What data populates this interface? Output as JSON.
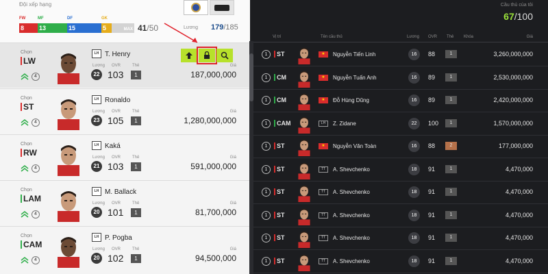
{
  "left_header": {
    "rank_title": "Đội xếp hạng",
    "pos_labels": [
      "FW",
      "MF",
      "DF",
      "GK"
    ],
    "bar_values": [
      "8",
      "13",
      "15",
      "5"
    ],
    "bar_max": "MAX",
    "count": "41",
    "count_total": "/50",
    "salary_label": "Lương",
    "salary": "179",
    "salary_total": "/185"
  },
  "card_labels": {
    "pick": "Chọn",
    "salary": "Lương",
    "ovr": "OVR",
    "grade": "Thẻ",
    "price": "Giá"
  },
  "cards": [
    {
      "pos": "LW",
      "club": "LH",
      "name": "T. Henry",
      "level": "4",
      "salary": "22",
      "ovr": "103",
      "grade": "1",
      "price": "187,000,000"
    },
    {
      "pos": "ST",
      "club": "LH",
      "name": "Ronaldo",
      "level": "4",
      "salary": "23",
      "ovr": "105",
      "grade": "1",
      "price": "1,280,000,000"
    },
    {
      "pos": "RW",
      "club": "LH",
      "name": "Kaká",
      "level": "4",
      "salary": "21",
      "ovr": "103",
      "grade": "1",
      "price": "591,000,000"
    },
    {
      "pos": "LAM",
      "club": "LH",
      "name": "M. Ballack",
      "level": "4",
      "salary": "20",
      "ovr": "101",
      "grade": "1",
      "price": "81,700,000"
    },
    {
      "pos": "CAM",
      "club": "LH",
      "name": "P. Pogba",
      "level": "4",
      "salary": "20",
      "ovr": "102",
      "grade": "1",
      "price": "94,500,000"
    }
  ],
  "right_header": {
    "my_label": "Cầu thủ của tôi",
    "my_count": "67",
    "my_total": "/100",
    "cols": [
      "Vị trí",
      "Tên cầu thủ",
      "Lương",
      "OVR",
      "Thẻ",
      "Khóa",
      "Giá"
    ]
  },
  "rows": [
    {
      "idx": "1",
      "pos": "ST",
      "badge": "★",
      "name": "Nguyễn Tiến Linh",
      "salary": "16",
      "ovr": "88",
      "grade": "1",
      "price": "3,260,000,000"
    },
    {
      "idx": "1",
      "pos": "CM",
      "badge": "★",
      "name": "Nguyễn Tuấn Anh",
      "salary": "16",
      "ovr": "89",
      "grade": "1",
      "price": "2,530,000,000"
    },
    {
      "idx": "1",
      "pos": "CM",
      "badge": "★",
      "name": "Đỗ Hùng Dũng",
      "salary": "16",
      "ovr": "89",
      "grade": "1",
      "price": "2,420,000,000"
    },
    {
      "idx": "1",
      "pos": "CAM",
      "badge": "LH",
      "name": "Z. Zidane",
      "salary": "22",
      "ovr": "100",
      "grade": "1",
      "price": "1,570,000,000"
    },
    {
      "idx": "1",
      "pos": "ST",
      "badge": "★",
      "name": "Nguyễn Văn Toàn",
      "salary": "16",
      "ovr": "88",
      "grade": "2",
      "price": "177,000,000"
    },
    {
      "idx": "1",
      "pos": "ST",
      "badge": "TT",
      "name": "A. Shevchenko",
      "salary": "18",
      "ovr": "91",
      "grade": "1",
      "price": "4,470,000"
    },
    {
      "idx": "1",
      "pos": "ST",
      "badge": "TT",
      "name": "A. Shevchenko",
      "salary": "18",
      "ovr": "91",
      "grade": "1",
      "price": "4,470,000"
    },
    {
      "idx": "1",
      "pos": "ST",
      "badge": "TT",
      "name": "A. Shevchenko",
      "salary": "18",
      "ovr": "91",
      "grade": "1",
      "price": "4,470,000"
    },
    {
      "idx": "1",
      "pos": "ST",
      "badge": "TT",
      "name": "A. Shevchenko",
      "salary": "18",
      "ovr": "91",
      "grade": "1",
      "price": "4,470,000"
    },
    {
      "idx": "1",
      "pos": "ST",
      "badge": "TT",
      "name": "A. Shevchenko",
      "salary": "18",
      "ovr": "91",
      "grade": "1",
      "price": "4,470,000"
    }
  ],
  "colors": {
    "fw": "#d92c2c",
    "mf": "#2fae4a",
    "df": "#2a6fd1",
    "gk": "#e6ad1b",
    "accent": "#b7e12b",
    "highlight": "#e0202a"
  }
}
